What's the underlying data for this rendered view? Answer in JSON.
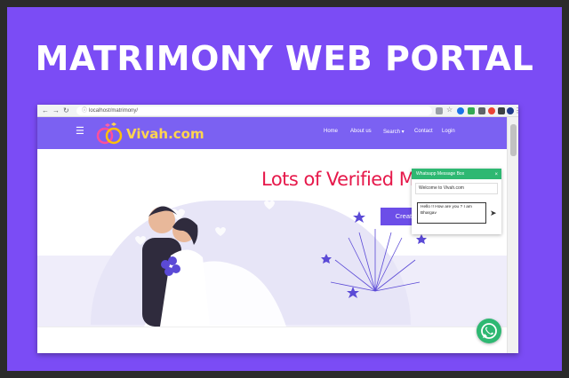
{
  "headline": "MATRIMONY WEB PORTAL",
  "browser": {
    "url": "localhost/matrimony/",
    "back_icon": "back-arrow-icon",
    "forward_icon": "forward-arrow-icon",
    "reload_icon": "reload-icon"
  },
  "site": {
    "logo_text": "Vivah.com",
    "menu": [
      {
        "label": "Home"
      },
      {
        "label": "About us"
      },
      {
        "label": "Search ▾"
      },
      {
        "label": "Contact"
      },
      {
        "label": "Login"
      }
    ]
  },
  "hero": {
    "title": "Lots of Verified Members",
    "cta_label": "Create your Profile"
  },
  "whatsapp": {
    "header": "Whatsapp Message Box",
    "close": "×",
    "welcome": "Welcome to Vivah.com",
    "message_line1": "Hello !! How are you ? I am",
    "message_line2": "Bhargav",
    "send_icon": "send-icon"
  },
  "colors": {
    "poster_bg": "#7b4cf5",
    "nav_bg": "#7b61f2",
    "title_red": "#e6194b",
    "cta_bg": "#6c4ee8",
    "whatsapp_green": "#2eb872",
    "logo_yellow": "#ffd54f"
  }
}
